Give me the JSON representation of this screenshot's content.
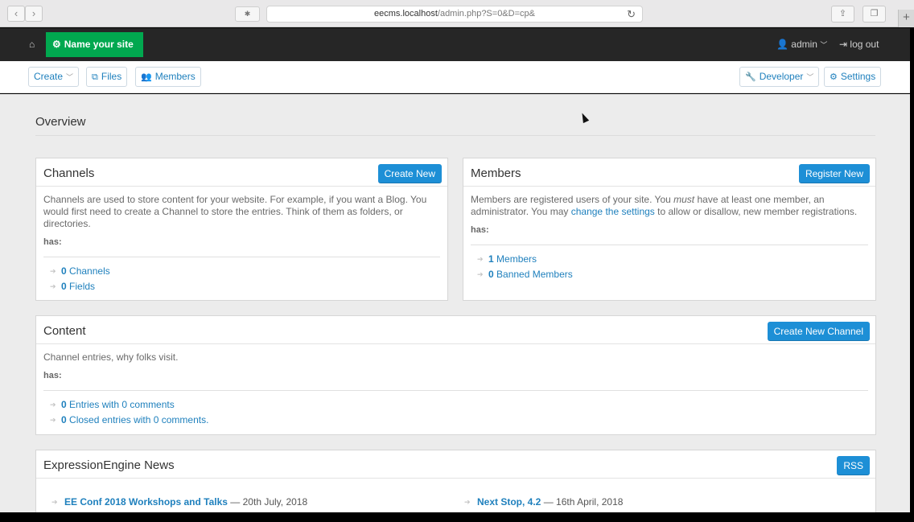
{
  "browser": {
    "url_host": "eecms.localhost",
    "url_path": "/admin.php?S=0&D=cp&"
  },
  "header": {
    "site_name": "Name your site",
    "user": "admin",
    "logout": "log out"
  },
  "toolbar": {
    "create": "Create",
    "files": "Files",
    "members": "Members",
    "developer": "Developer",
    "settings": "Settings"
  },
  "overview": {
    "title": "Overview"
  },
  "channels": {
    "title": "Channels",
    "button": "Create New",
    "desc": "Channels are used to store content for your website. For example, if you want a Blog. You would first need to create a Channel to store the entries. Think of them as folders, or directories.",
    "has": "has:",
    "stats": [
      {
        "count": "0",
        "label": "Channels"
      },
      {
        "count": "0",
        "label": "Fields"
      }
    ]
  },
  "members": {
    "title": "Members",
    "button": "Register New",
    "desc_1": "Members are registered users of your site. You ",
    "desc_em": "must",
    "desc_2": " have at least one member, an administrator. You may ",
    "desc_link": "change the settings",
    "desc_3": " to allow or disallow, new member registrations.",
    "has": "has:",
    "stats": [
      {
        "count": "1",
        "label": "Members"
      },
      {
        "count": "0",
        "label": "Banned Members"
      }
    ]
  },
  "content": {
    "title": "Content",
    "button": "Create New Channel",
    "desc": "Channel entries, why folks visit.",
    "has": "has:",
    "stats": [
      {
        "count": "0",
        "label": "Entries with 0 comments"
      },
      {
        "count": "0",
        "label": "Closed entries with 0 comments."
      }
    ]
  },
  "news": {
    "title": "ExpressionEngine News",
    "button": "RSS",
    "items": [
      {
        "title": "EE Conf 2018 Workshops and Talks",
        "date": "— 20th July, 2018"
      },
      {
        "title": "Next Stop, 4.2",
        "date": "— 16th April, 2018"
      }
    ]
  }
}
